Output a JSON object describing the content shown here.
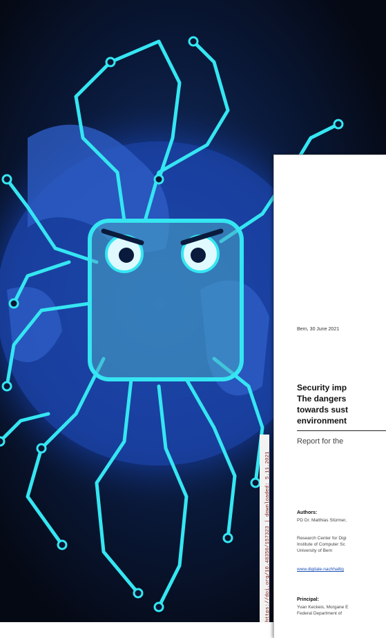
{
  "cover": {
    "doi_line": "https://doi.org/10.48350/157323 | downloaded: 5.11.2021"
  },
  "report": {
    "date": "Bern, 30 June 2021",
    "title_lines": [
      "Security imp",
      "The dangers",
      "towards sust",
      "environment"
    ],
    "subtitle": "Report for the",
    "authors_label": "Authors:",
    "authors_text": "PD Dr. Matthias Stürmer,",
    "institution_lines": [
      "Research Center for Digi",
      "Institute of Computer Sc",
      "University of Bern"
    ],
    "website": "www.digitale-nachhaltig",
    "principal_label": "Principal:",
    "principal_lines": [
      "Yvan Keckeis, Morgane E",
      "Federal Department of"
    ]
  },
  "colors": {
    "circuit": "#35e6f2",
    "globe": "#1f5fd6",
    "background": "#0a1a3c"
  }
}
